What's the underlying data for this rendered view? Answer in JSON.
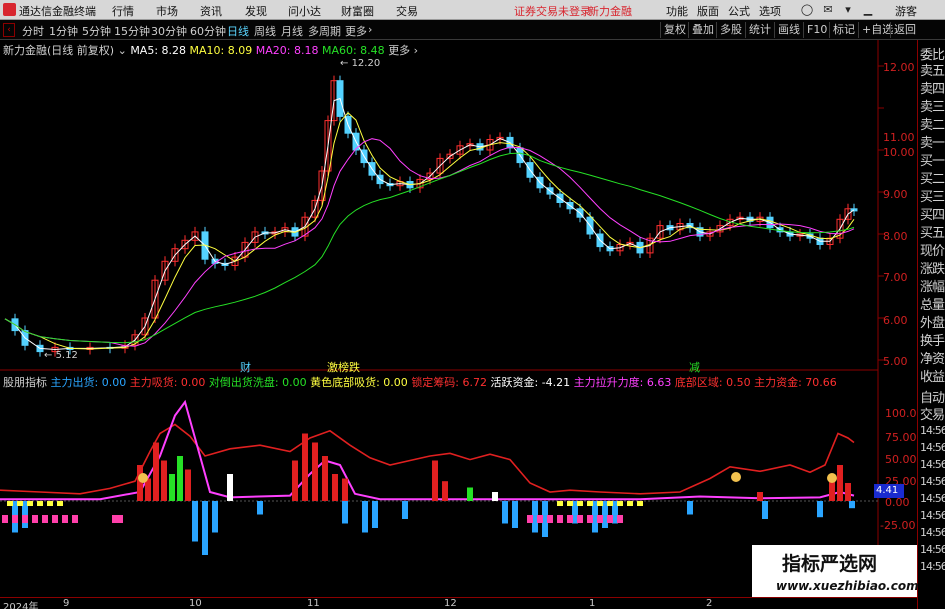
{
  "app_title": "通达信金融终端",
  "menu": [
    "行情",
    "市场",
    "资讯",
    "发现",
    "问小达",
    "财富圈",
    "交易"
  ],
  "menu_red": [
    "证券交易未登录",
    "新力金融"
  ],
  "menu_right": [
    "功能",
    "版面",
    "公式",
    "选项"
  ],
  "guest": "游客",
  "sys_r": "R",
  "periods": [
    "分时",
    "1分钟",
    "5分钟",
    "15分钟",
    "30分钟",
    "60分钟",
    "日线",
    "周线",
    "月线",
    "多周期",
    "更多"
  ],
  "active_period": "日线",
  "toolbar_right": [
    "复权",
    "叠加",
    "多股",
    "统计",
    "画线",
    "F10",
    "标记",
    "+自选",
    "返回"
  ],
  "main_title": {
    "stock": "新力金融(日线 前复权)",
    "ma5": "MA5: 8.28",
    "ma10": "MA10: 8.09",
    "ma20": "MA20: 8.18",
    "ma60": "MA60: 8.48"
  },
  "price_axis": [
    "12.00",
    "11.00",
    "10.00",
    "9.00",
    "8.00",
    "7.00",
    "6.00",
    "5.00"
  ],
  "annotations": {
    "high": "12.20",
    "low": "5.12",
    "cai": "财",
    "jing": "激榜跌",
    "jian": "减"
  },
  "indicator_title": {
    "name": "股朋指标",
    "items": [
      {
        "label": "主力出货: 0.00",
        "color": "#2aa5ff"
      },
      {
        "label": "主力吸货: 0.00",
        "color": "#ff3030"
      },
      {
        "label": "对倒出货洗盘: 0.00",
        "color": "#26e026"
      },
      {
        "label": "黄色底部吸货: 0.00",
        "color": "#ffff40"
      },
      {
        "label": "锁定筹码: 6.72",
        "color": "#ff3030"
      },
      {
        "label": "活跃资金: -4.21",
        "color": "#ffffff"
      },
      {
        "label": "主力拉升力度: 6.63",
        "color": "#ff40ff"
      },
      {
        "label": "底部区域: 0.50",
        "color": "#ff3030"
      },
      {
        "label": "主力资金: 70.66",
        "color": "#ff3030"
      }
    ]
  },
  "ind_axis": [
    "100.0",
    "75.00",
    "50.00",
    "25.00",
    "0.00",
    "-25.00"
  ],
  "ind_value_badge": "4.41",
  "quote_labels": [
    "委比",
    "卖五",
    "卖四",
    "卖三",
    "卖二",
    "卖一",
    "买一",
    "买二",
    "买三",
    "买四",
    "买五",
    "现价",
    "涨跌",
    "涨幅",
    "总量",
    "外盘",
    "换手",
    "净资",
    "收益"
  ],
  "quote_lower": [
    "自动",
    "交易",
    "14:56",
    "14:56",
    "14:56",
    "14:56",
    "14:56",
    "14:56",
    "14:56",
    "14:56",
    "14:56"
  ],
  "date_axis": [
    "2024年",
    "9",
    "10",
    "11",
    "12",
    "1",
    "2"
  ],
  "watermark": {
    "title": "指标严选网",
    "url": "www.xuezhibiao.com"
  },
  "colors": {
    "up": "#ff3030",
    "down": "#54d2ff",
    "ma5": "#ffffff",
    "ma10": "#ffff40",
    "ma20": "#ff40ff",
    "ma60": "#26e026"
  }
}
